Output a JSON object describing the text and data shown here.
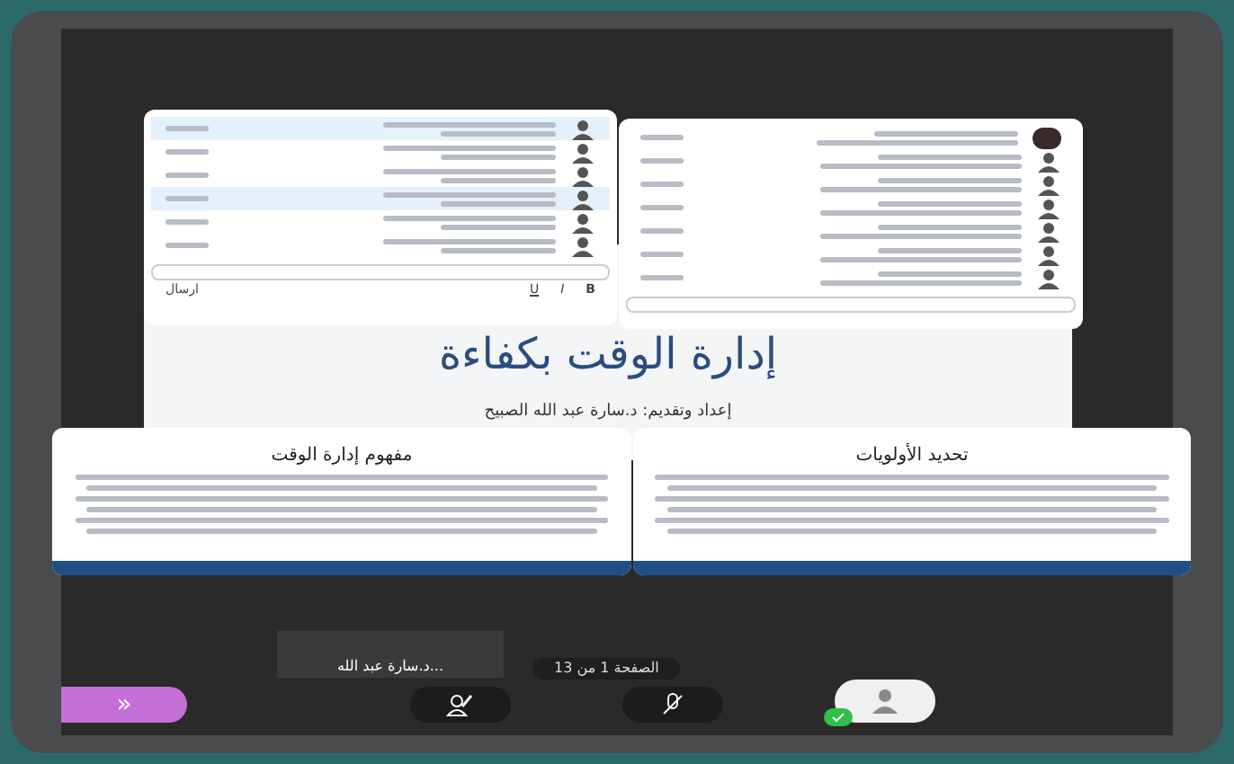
{
  "slide": {
    "title": "إدارة الوقت بكفاءة",
    "subtitle": "إعداد وتقديم: د.سارة عبد الله الصبيح"
  },
  "chat_left": {
    "rows": [
      {
        "highlighted": true
      },
      {
        "highlighted": false
      },
      {
        "highlighted": false
      },
      {
        "highlighted": true
      },
      {
        "highlighted": false
      },
      {
        "highlighted": false
      }
    ],
    "send": "ارسال",
    "toolbar": [
      {
        "label": "B",
        "kind": "bold"
      },
      {
        "label": "I",
        "kind": "italic"
      },
      {
        "label": "U",
        "kind": "underline"
      }
    ]
  },
  "chat_right": {
    "rows": [
      {
        "kind": "photo"
      },
      {
        "kind": "avatar"
      },
      {
        "kind": "avatar"
      },
      {
        "kind": "avatar"
      },
      {
        "kind": "avatar"
      },
      {
        "kind": "avatar"
      },
      {
        "kind": "avatar"
      }
    ]
  },
  "thumbnails": [
    {
      "title": "تحديد الأولويات"
    },
    {
      "title": "مفهوم إدارة الوقت"
    }
  ],
  "presenter": {
    "name": "د.سارة عبد الله..."
  },
  "page_indicator": "الصفحة 1 من 13",
  "toolbar": {
    "expand": "»",
    "mic_muted": true,
    "user_ready": true
  }
}
